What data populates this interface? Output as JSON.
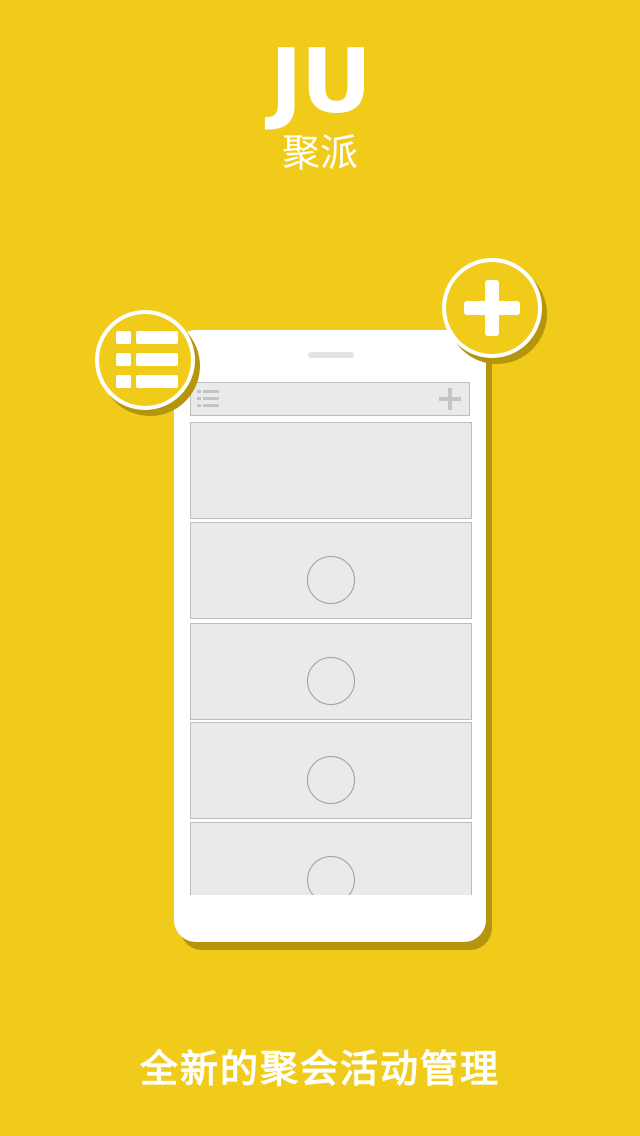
{
  "brand": {
    "logo": "JU",
    "name_cn": "聚派"
  },
  "phone_mockup": {
    "icons": [
      "list-icon",
      "plus-icon"
    ],
    "cards": [
      {
        "has_avatar": false
      },
      {
        "has_avatar": true
      },
      {
        "has_avatar": true
      },
      {
        "has_avatar": true
      },
      {
        "has_avatar": true
      }
    ]
  },
  "floating_buttons": {
    "left_icon": "list-icon",
    "right_icon": "plus-icon"
  },
  "tagline": "全新的聚会活动管理",
  "colors": {
    "background": "#F1CB1A",
    "shadow": "#B5950C",
    "card": "#EAEAEA",
    "card_border": "#BDBDBD",
    "white": "#FFFFFF"
  }
}
